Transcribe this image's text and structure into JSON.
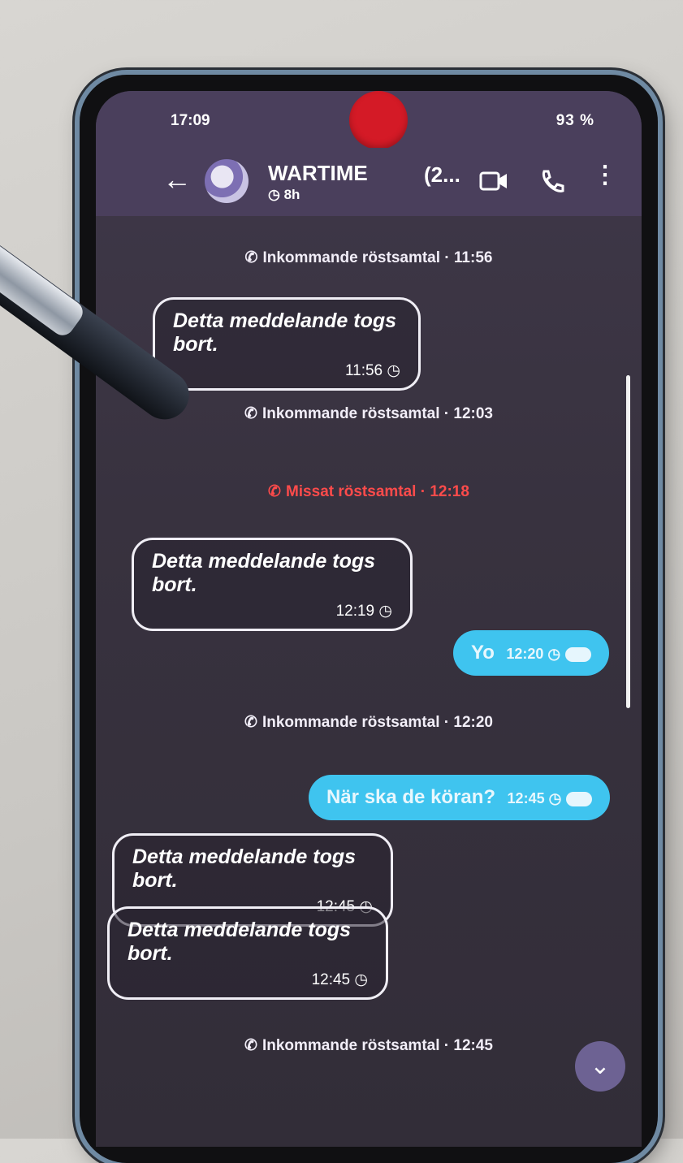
{
  "status_bar": {
    "time": "17:09",
    "right": "93 %"
  },
  "header": {
    "back_icon": "arrow-left-icon",
    "title": "WARTIME",
    "subtitle": "8h",
    "count": "(2...",
    "icons": [
      "video-icon",
      "phone-icon",
      "more-vertical-icon"
    ]
  },
  "messages": [
    {
      "type": "system",
      "text": "Inkommande röstsamtal · 11:56"
    },
    {
      "type": "incoming",
      "text": "Detta meddelande togs bort.",
      "time": "11:56"
    },
    {
      "type": "system",
      "text": "Inkommande röstsamtal · 12:03"
    },
    {
      "type": "missed",
      "text": "Missat röstsamtal · 12:18"
    },
    {
      "type": "incoming",
      "text": "Detta meddelande togs bort.",
      "time": "12:19"
    },
    {
      "type": "outgoing",
      "text": "Yo",
      "time": "12:20"
    },
    {
      "type": "system",
      "text": "Inkommande röstsamtal · 12:20"
    },
    {
      "type": "outgoing",
      "text": "När ska de köran?",
      "time": "12:45"
    },
    {
      "type": "incoming",
      "text": "Detta meddelande togs bort.",
      "time": "12:45"
    },
    {
      "type": "incoming",
      "text": "Detta meddelande togs bort.",
      "time": "12:45"
    },
    {
      "type": "system",
      "text": "Inkommande röstsamtal · 12:45"
    }
  ]
}
